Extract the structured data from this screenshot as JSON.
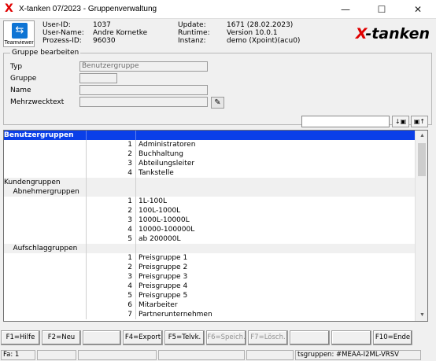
{
  "window": {
    "title": "X-tanken 07/2023 - Gruppenverwaltung",
    "app_glyph": "X",
    "controls": [
      "—",
      "☐",
      "✕"
    ]
  },
  "header": {
    "teamviewer_label": "Teamviewer",
    "user_id_label": "User-ID:",
    "user_id": "1037",
    "user_name_label": "User-Name:",
    "user_name": "Andre Kornetke",
    "process_id_label": "Prozess-ID:",
    "process_id": "96030",
    "update_label": "Update:",
    "update": "1671 (28.02.2023)",
    "runtime_label": "Runtime:",
    "runtime": "Version 10.0.1",
    "instance_label": "Instanz:",
    "instance": "demo (Xpoint)(acu0)",
    "logo_x": "X",
    "logo_rest": "-tanken"
  },
  "group_edit": {
    "legend": "Gruppe bearbeiten",
    "type_label": "Typ",
    "type_value": "Benutzergruppe",
    "group_label": "Gruppe",
    "group_value": "",
    "name_label": "Name",
    "name_value": "",
    "multi_label": "Mehrzwecktext",
    "multi_value": "",
    "edit_icon": "✎"
  },
  "search": {
    "value": "",
    "find_down_label": "↓▣",
    "find_up_label": "▣↑"
  },
  "list": {
    "rows": [
      {
        "c1": "Benutzergruppen",
        "c2": "",
        "c3": "",
        "kind": "sel"
      },
      {
        "c1": "",
        "c2": "1",
        "c3": "Administratoren",
        "kind": ""
      },
      {
        "c1": "",
        "c2": "2",
        "c3": "Buchhaltung",
        "kind": ""
      },
      {
        "c1": "",
        "c2": "3",
        "c3": "Abteilungsleiter",
        "kind": ""
      },
      {
        "c1": "",
        "c2": "4",
        "c3": "Tankstelle",
        "kind": ""
      },
      {
        "c1": "Kundengruppen",
        "c2": "",
        "c3": "",
        "kind": "grp"
      },
      {
        "c1": "    Abnehmergruppen",
        "c2": "",
        "c3": "",
        "kind": "grp"
      },
      {
        "c1": "",
        "c2": "1",
        "c3": "1L-100L",
        "kind": ""
      },
      {
        "c1": "",
        "c2": "2",
        "c3": "100L-1000L",
        "kind": ""
      },
      {
        "c1": "",
        "c2": "3",
        "c3": "1000L-10000L",
        "kind": ""
      },
      {
        "c1": "",
        "c2": "4",
        "c3": "10000-100000L",
        "kind": ""
      },
      {
        "c1": "",
        "c2": "5",
        "c3": "ab 200000L",
        "kind": ""
      },
      {
        "c1": "    Aufschlaggruppen",
        "c2": "",
        "c3": "",
        "kind": "grp"
      },
      {
        "c1": "",
        "c2": "1",
        "c3": "Preisgruppe 1",
        "kind": ""
      },
      {
        "c1": "",
        "c2": "2",
        "c3": "Preisgruppe 2",
        "kind": ""
      },
      {
        "c1": "",
        "c2": "3",
        "c3": "Preisgruppe 3",
        "kind": ""
      },
      {
        "c1": "",
        "c2": "4",
        "c3": "Preisgruppe 4",
        "kind": ""
      },
      {
        "c1": "",
        "c2": "5",
        "c3": "Preisgruppe 5",
        "kind": ""
      },
      {
        "c1": "",
        "c2": "6",
        "c3": "Mitarbeiter",
        "kind": ""
      },
      {
        "c1": "",
        "c2": "7",
        "c3": "Partnerunternehmen",
        "kind": ""
      }
    ],
    "scroll_up": "▲",
    "scroll_down": "▼"
  },
  "fkeys": [
    {
      "label": "F1=Hilfe",
      "enabled": true
    },
    {
      "label": "F2=Neu",
      "enabled": true
    },
    {
      "label": "",
      "enabled": false
    },
    {
      "label": "F4=Export",
      "enabled": true
    },
    {
      "label": "F5=Telvk.",
      "enabled": true
    },
    {
      "label": "F6=Speich.",
      "enabled": false
    },
    {
      "label": "F7=Lösch.",
      "enabled": false
    },
    {
      "label": "",
      "enabled": false
    },
    {
      "label": "",
      "enabled": false
    },
    {
      "label": "F10=Ende",
      "enabled": true
    }
  ],
  "status": {
    "firma": "Fa: 1",
    "program": "tsgruppen: #MEAA-I2ML-VRSV"
  },
  "colors": {
    "selection": "#0a3fe8",
    "logo_red": "#e00000"
  }
}
